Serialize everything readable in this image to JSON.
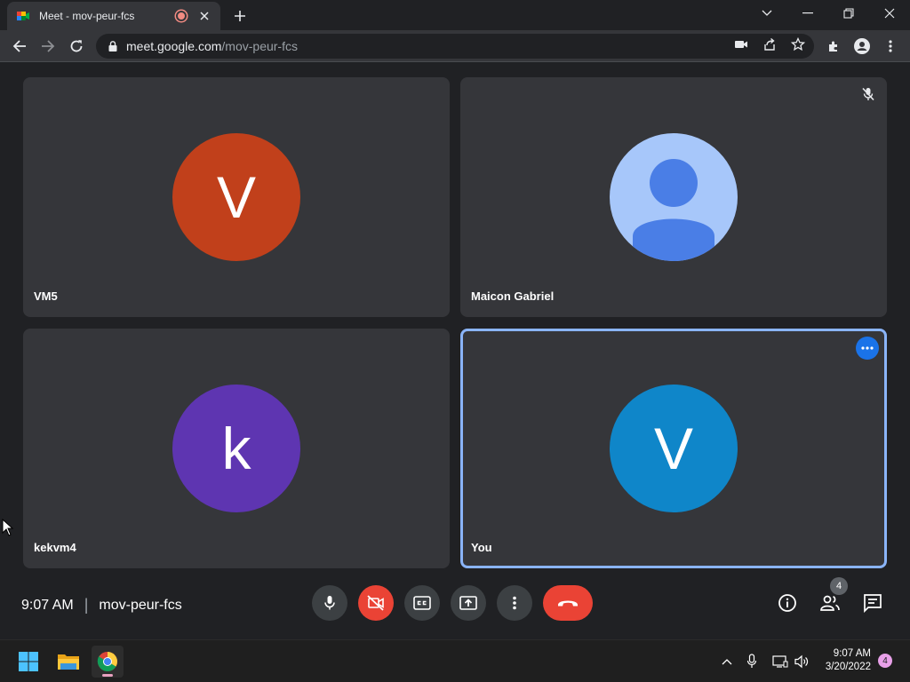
{
  "browser": {
    "tab_title": "Meet - mov-peur-fcs",
    "url_host": "meet.google.com",
    "url_path": "/mov-peur-fcs"
  },
  "tiles": [
    {
      "name": "VM5",
      "initial": "V",
      "avatar_color": "#c1401b"
    },
    {
      "name": "Maicon Gabriel",
      "initial": "",
      "avatar_color": "#a7c7fa",
      "muted": true
    },
    {
      "name": "kekvm4",
      "initial": "k",
      "avatar_color": "#5e35b1"
    },
    {
      "name": "You",
      "initial": "V",
      "avatar_color": "#0f86c9",
      "active": true
    }
  ],
  "meeting": {
    "time": "9:07 AM",
    "separator": "|",
    "code": "mov-peur-fcs",
    "participants_count": "4"
  },
  "taskbar": {
    "time": "9:07 AM",
    "date": "3/20/2022",
    "notifications": "4"
  },
  "colors": {
    "end_call": "#ea4335",
    "active_border": "#8ab4f8",
    "accent_blue": "#1a73e8"
  }
}
